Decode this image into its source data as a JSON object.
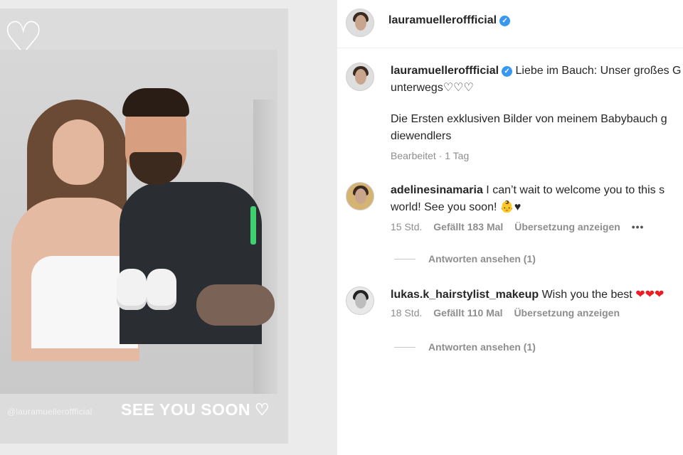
{
  "post": {
    "story_handle": "@lauramuelleroffficial",
    "story_caption": "SEE YOU SOON",
    "story_caption_heart": "♡",
    "doodle_heart": "♡"
  },
  "header": {
    "username": "lauramuelleroffficial",
    "verified_mark": "✓"
  },
  "caption": {
    "username": "lauramuelleroffficial",
    "verified_mark": "✓",
    "line1": "Liebe im Bauch: Unser großes G",
    "line2": "unterwegs♡♡♡",
    "line3": "Die Ersten exklusiven Bilder von meinem Babybauch g",
    "line4": "diewendlers",
    "meta": "Bearbeitet · 1 Tag"
  },
  "comments": [
    {
      "username": "adelinesinamaria",
      "line1": "I can’t wait to welcome you to this s",
      "line2": "world! See you soon! 👶♥",
      "time": "15 Std.",
      "likes": "Gefällt 183 Mal",
      "translate": "Übersetzung anzeigen",
      "more": "•••",
      "replies": "Antworten ansehen (1)"
    },
    {
      "username": "lukas.k_hairstylist_makeup",
      "line1": "Wish you the best",
      "hearts": "❤❤❤",
      "time": "18 Std.",
      "likes": "Gefällt 110 Mal",
      "translate": "Übersetzung anzeigen",
      "replies": "Antworten ansehen (1)"
    }
  ],
  "colors": {
    "verified": "#3897f0",
    "heart_red": "#ed1c24",
    "meta_gray": "#8e8e8e"
  }
}
